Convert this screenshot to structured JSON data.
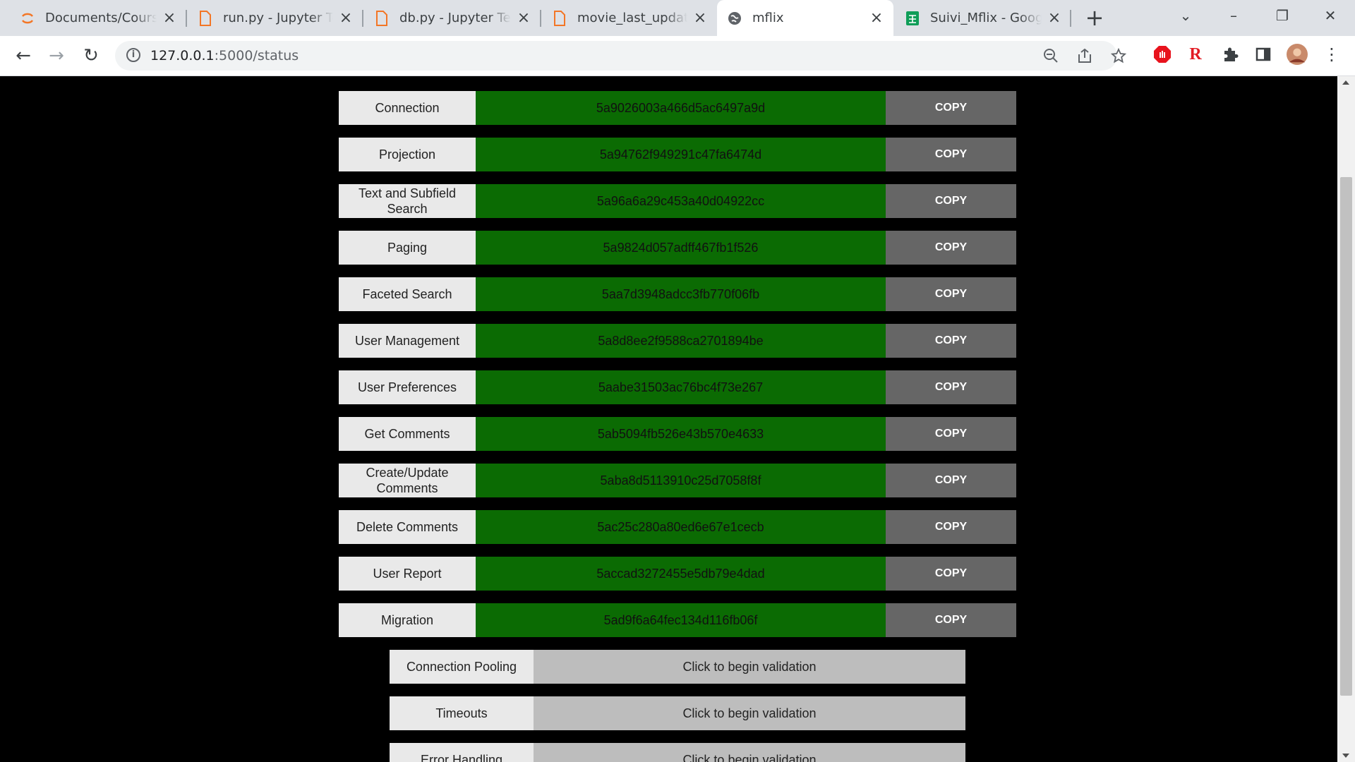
{
  "browser": {
    "tabs": [
      {
        "title": "Documents/Cours/",
        "icon": "jupyter-icon"
      },
      {
        "title": "run.py - Jupyter Text",
        "icon": "file-icon"
      },
      {
        "title": "db.py - Jupyter Text",
        "icon": "file-icon"
      },
      {
        "title": "movie_last_updated",
        "icon": "file-icon"
      },
      {
        "title": "mflix",
        "icon": "globe-icon"
      },
      {
        "title": "Suivi_Mflix - Google",
        "icon": "sheets-icon"
      }
    ],
    "url_host": "127.0.0.1",
    "url_path": ":5000/status"
  },
  "tickets": [
    {
      "label": "Connection",
      "value": "5a9026003a466d5ac6497a9d",
      "copy": "COPY"
    },
    {
      "label": "Projection",
      "value": "5a94762f949291c47fa6474d",
      "copy": "COPY"
    },
    {
      "label": "Text and Subfield Search",
      "value": "5a96a6a29c453a40d04922cc",
      "copy": "COPY"
    },
    {
      "label": "Paging",
      "value": "5a9824d057adff467fb1f526",
      "copy": "COPY"
    },
    {
      "label": "Faceted Search",
      "value": "5aa7d3948adcc3fb770f06fb",
      "copy": "COPY"
    },
    {
      "label": "User Management",
      "value": "5a8d8ee2f9588ca2701894be",
      "copy": "COPY"
    },
    {
      "label": "User Preferences",
      "value": "5aabe31503ac76bc4f73e267",
      "copy": "COPY"
    },
    {
      "label": "Get Comments",
      "value": "5ab5094fb526e43b570e4633",
      "copy": "COPY"
    },
    {
      "label": "Create/Update Comments",
      "value": "5aba8d5113910c25d7058f8f",
      "copy": "COPY"
    },
    {
      "label": "Delete Comments",
      "value": "5ac25c280a80ed6e67e1cecb",
      "copy": "COPY"
    },
    {
      "label": "User Report",
      "value": "5accad3272455e5db79e4dad",
      "copy": "COPY"
    },
    {
      "label": "Migration",
      "value": "5ad9f6a64fec134d116fb06f",
      "copy": "COPY"
    }
  ],
  "validations": [
    {
      "label": "Connection Pooling",
      "action": "Click to begin validation"
    },
    {
      "label": "Timeouts",
      "action": "Click to begin validation"
    },
    {
      "label": "Error Handling",
      "action": "Click to begin validation"
    }
  ],
  "colors": {
    "ticket_green": "#0b6b03",
    "copy_gray": "#666666",
    "validate_gray": "#bdbdbd"
  }
}
